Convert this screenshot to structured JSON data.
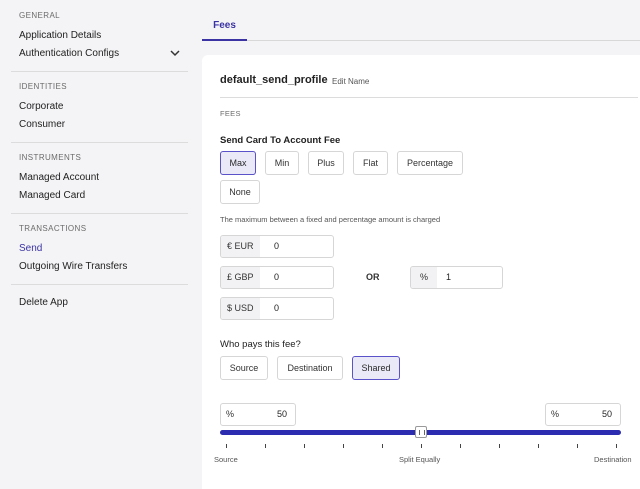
{
  "sidebar": {
    "sections": [
      {
        "label": "GENERAL",
        "items": [
          "Application Details",
          "Authentication Configs"
        ]
      },
      {
        "label": "IDENTITIES",
        "items": [
          "Corporate",
          "Consumer"
        ]
      },
      {
        "label": "INSTRUMENTS",
        "items": [
          "Managed Account",
          "Managed Card"
        ]
      },
      {
        "label": "TRANSACTIONS",
        "items": [
          "Send",
          "Outgoing Wire Transfers"
        ]
      }
    ],
    "delete_label": "Delete App",
    "active_item": "Send",
    "icons": {
      "expand": "chevron-down-icon"
    }
  },
  "tabs": {
    "active": "Fees"
  },
  "profile": {
    "name": "default_send_profile",
    "edit_label": "Edit Name"
  },
  "fees": {
    "section_label": "FEES",
    "question": "Send Card To Account Fee",
    "types": [
      "Max",
      "Min",
      "Plus",
      "Flat",
      "Percentage",
      "None"
    ],
    "selected_type": "Max",
    "description": "The maximum between a fixed and percentage amount is charged",
    "currencies": [
      {
        "label": "€ EUR",
        "value": "0"
      },
      {
        "label": "£ GBP",
        "value": "0"
      },
      {
        "label": "$ USD",
        "value": "0"
      }
    ],
    "or_label": "OR",
    "percentage": {
      "symbol": "%",
      "value": "1"
    }
  },
  "payer": {
    "question": "Who pays this fee?",
    "options": [
      "Source",
      "Destination",
      "Shared"
    ],
    "selected": "Shared"
  },
  "split": {
    "left": {
      "symbol": "%",
      "value": "50"
    },
    "right": {
      "symbol": "%",
      "value": "50"
    },
    "labels": {
      "start": "Source",
      "middle": "Split Equally",
      "end": "Destination"
    },
    "slider_fraction": 0.5
  },
  "colors": {
    "accent": "#3b33a3",
    "track": "#2c2cb0",
    "selected_bg": "#eae9f8"
  }
}
